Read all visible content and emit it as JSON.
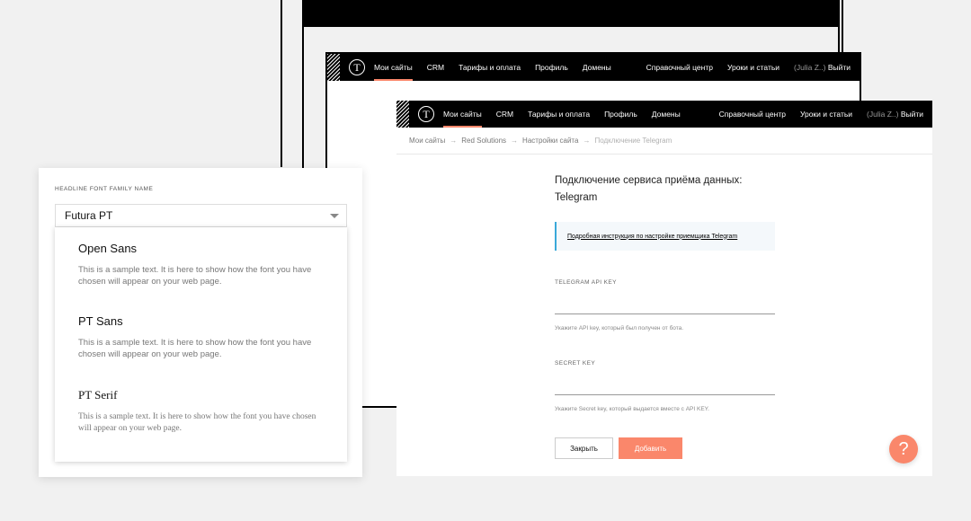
{
  "nav": {
    "items": [
      "Мои сайты",
      "CRM",
      "Тарифы и оплата",
      "Профиль",
      "Домены"
    ],
    "right": {
      "help": "Справочный центр",
      "lessons": "Уроки и статьи",
      "user": "(Julia Z..)",
      "logout": "Выйти"
    }
  },
  "breadcrumbs": [
    "Мои сайты",
    "Red Solutions",
    "Настройки сайта",
    "Подключение Telegram"
  ],
  "form": {
    "title": "Подключение сервиса приёма данных: Telegram",
    "info_link": "Подробная инструкция по настройке приемщика Telegram",
    "api_label": "TELEGRAM API KEY",
    "api_hint": "Укажите API key, который был получен от бота.",
    "secret_label": "SECRET KEY",
    "secret_hint": "Укажите Secret key, который выдается вместе с API KEY.",
    "close_btn": "Закрыть",
    "add_btn": "Добавить"
  },
  "help_btn": "?",
  "font_panel": {
    "label": "HEADLINE FONT FAMILY NAME",
    "selected": "Futura PT",
    "options": [
      {
        "name": "Open Sans",
        "sample": "This is a sample text. It is here to show how the font you have chosen will appear on your web page."
      },
      {
        "name": "PT Sans",
        "sample": "This is a sample text. It is here to show how the font you have chosen will appear on your web page."
      },
      {
        "name": "PT Serif",
        "sample": "This is a sample text. It is here to show how the font you have chosen will appear on your web page."
      }
    ]
  },
  "colors": {
    "accent": "#fa876b",
    "info_border": "#3aa9d9"
  }
}
